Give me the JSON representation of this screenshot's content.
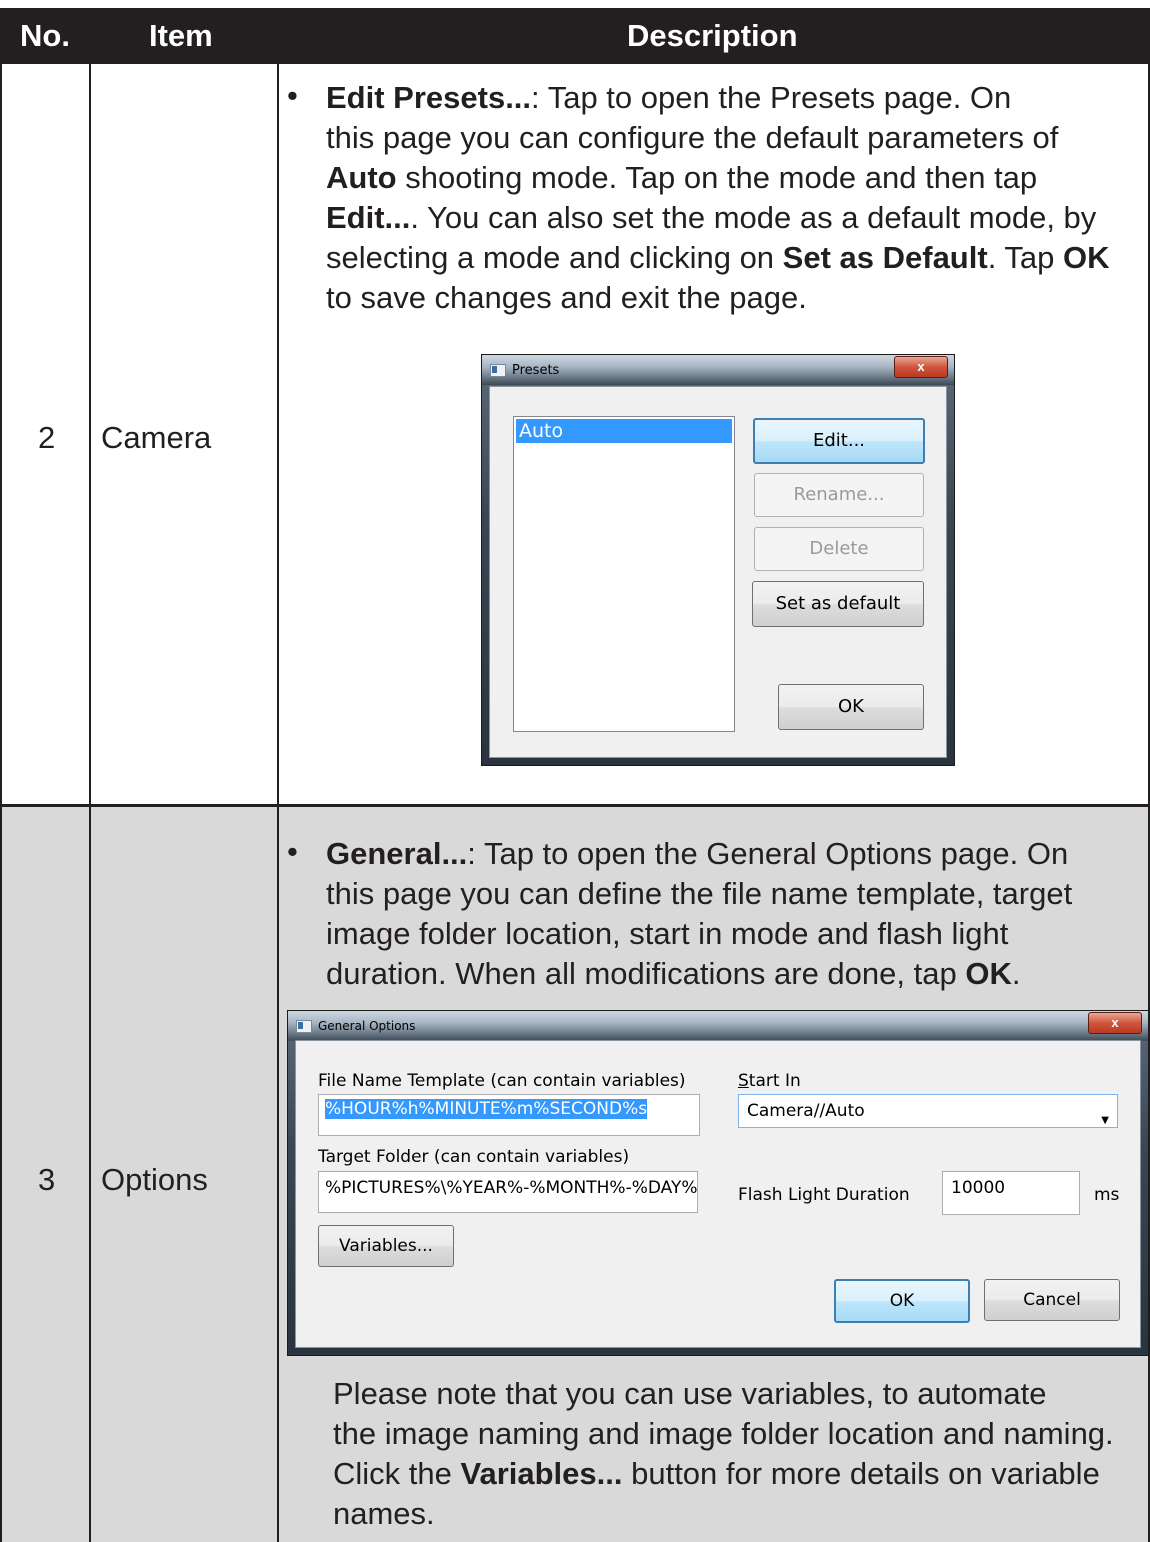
{
  "table": {
    "headers": {
      "no": "No.",
      "item": "Item",
      "description": "Description"
    },
    "rows": [
      {
        "no": "2",
        "item": "Camera",
        "lines": [
          "Edit Presets...: Tap to open the Presets page. On",
          "this page you can configure the default parameters of",
          "Auto shooting mode. Tap on the mode and then tap",
          "Edit..... You can also set the mode as a default mode, by",
          "selecting a mode and clicking on Set as Default. Tap OK",
          "to save changes and exit the page."
        ]
      },
      {
        "no": "3",
        "item": "Options",
        "lines": [
          "General...: Tap to open the General Options page. On",
          "this page you can define the file name template, target",
          "image folder location, start in mode and flash light",
          "duration. When all modifications are done, tap OK."
        ],
        "note_lines": [
          "Please note that you can use variables, to automate",
          "the image naming and image folder location and naming.",
          "Click the Variables... button for more details on variable",
          "names."
        ]
      }
    ]
  },
  "presets_dialog": {
    "title": "Presets",
    "close": "x",
    "list_items": [
      "Auto"
    ],
    "buttons": {
      "edit": "Edit...",
      "rename": "Rename...",
      "delete": "Delete",
      "set_default": "Set as default",
      "ok": "OK"
    }
  },
  "general_dialog": {
    "title": "General Options",
    "close": "x",
    "file_name_label": "File Name Template (can contain variables)",
    "file_name_value": "%HOUR%h%MINUTE%m%SECOND%s",
    "start_in_label": "Start In",
    "start_in_value": "Camera//Auto",
    "target_folder_label": "Target Folder (can contain variables)",
    "target_folder_value": "%PICTURES%\\%YEAR%-%MONTH%-%DAY%",
    "flash_label": "Flash Light Duration",
    "flash_value": "10000",
    "flash_unit": "ms",
    "variables_button": "Variables...",
    "ok_button": "OK",
    "cancel_button": "Cancel"
  },
  "colors": {
    "header_bg": "#231f20",
    "shade": "#d9d9da",
    "selection": "#3399ff"
  }
}
